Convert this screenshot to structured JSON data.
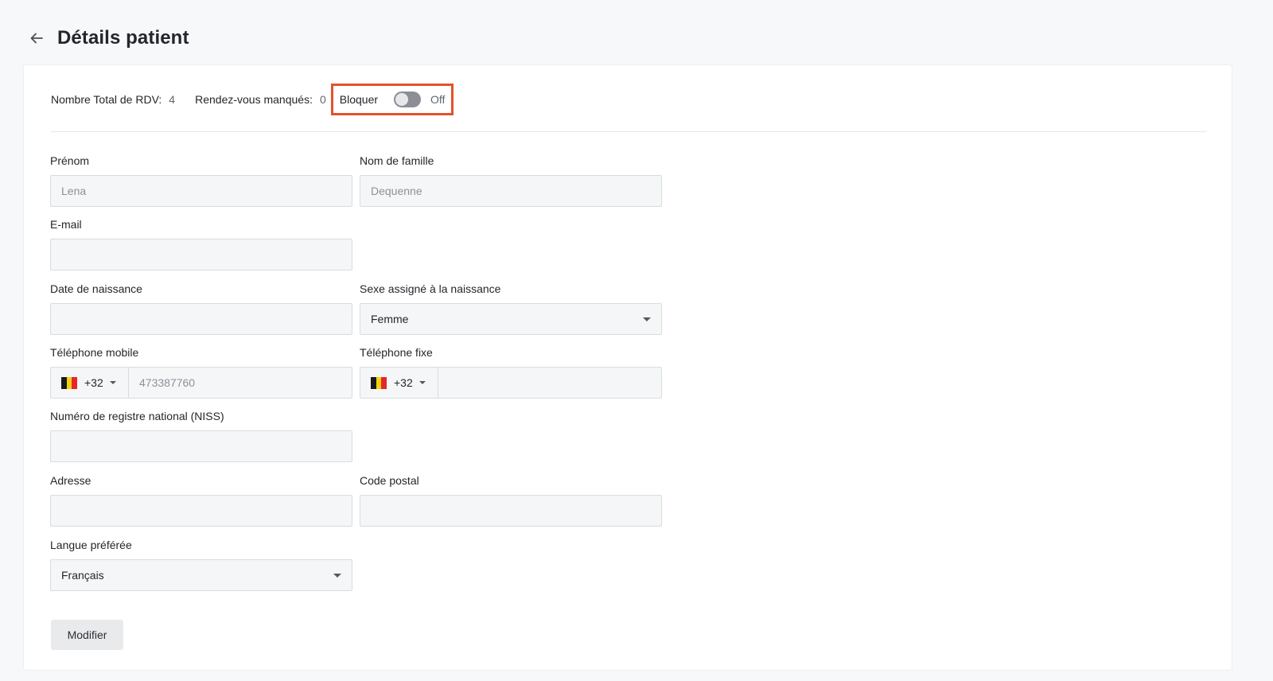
{
  "page": {
    "title": "Détails patient"
  },
  "stats": {
    "total_label": "Nombre Total de RDV:",
    "total_value": "4",
    "missed_label": "Rendez-vous manqués:",
    "missed_value": "0",
    "block_label": "Bloquer",
    "block_state": "Off"
  },
  "form": {
    "first_name": {
      "label": "Prénom",
      "placeholder": "Lena"
    },
    "last_name": {
      "label": "Nom de famille",
      "placeholder": "Dequenne"
    },
    "email": {
      "label": "E-mail",
      "value": ""
    },
    "birth_date": {
      "label": "Date de naissance",
      "value": ""
    },
    "sex": {
      "label": "Sexe assigné à la naissance",
      "value": "Femme"
    },
    "mobile": {
      "label": "Téléphone mobile",
      "dial_code": "+32",
      "placeholder": "473387760"
    },
    "landline": {
      "label": "Téléphone fixe",
      "dial_code": "+32",
      "value": ""
    },
    "niss": {
      "label": "Numéro de registre national (NISS)",
      "value": ""
    },
    "address": {
      "label": "Adresse",
      "value": ""
    },
    "postal_code": {
      "label": "Code postal",
      "value": ""
    },
    "language": {
      "label": "Langue préférée",
      "value": "Français"
    }
  },
  "actions": {
    "modify_label": "Modifier"
  },
  "icons": {
    "back": "arrow-left-icon",
    "dropdown": "caret-down-icon",
    "flag": "belgium-flag-icon"
  },
  "colors": {
    "highlight": "#e4512b",
    "flag_black": "#1a1a1a",
    "flag_yellow": "#f5d20f",
    "flag_red": "#e5262b"
  }
}
